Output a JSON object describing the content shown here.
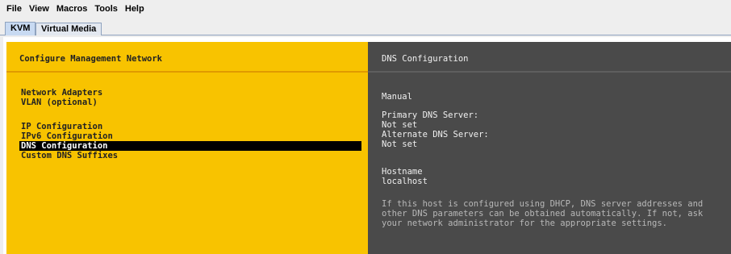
{
  "menubar": {
    "items": [
      "File",
      "View",
      "Macros",
      "Tools",
      "Help"
    ]
  },
  "tabs": [
    {
      "label": "KVM",
      "active": true
    },
    {
      "label": "Virtual Media",
      "active": false
    }
  ],
  "console": {
    "left": {
      "title": "Configure Management Network",
      "options": [
        "Network Adapters",
        "VLAN (optional)",
        "IP Configuration",
        "IPv6 Configuration",
        "DNS Configuration",
        "Custom DNS Suffixes"
      ],
      "selected": "DNS Configuration"
    },
    "right": {
      "title": "DNS Configuration",
      "mode": "Manual",
      "primary_label": "Primary DNS Server:",
      "primary_value": "Not set",
      "alternate_label": "Alternate DNS Server:",
      "alternate_value": "Not set",
      "hostname_label": "Hostname",
      "hostname_value": "localhost",
      "note": "If this host is configured using DHCP, DNS server addresses and other DNS parameters can be obtained automatically. If not, ask your network administrator for the appropriate settings."
    }
  },
  "colors": {
    "left_pane": "#f8c300",
    "right_pane": "#4a4a4a",
    "selection": "#000000",
    "tab_active": "#c8daf2"
  }
}
